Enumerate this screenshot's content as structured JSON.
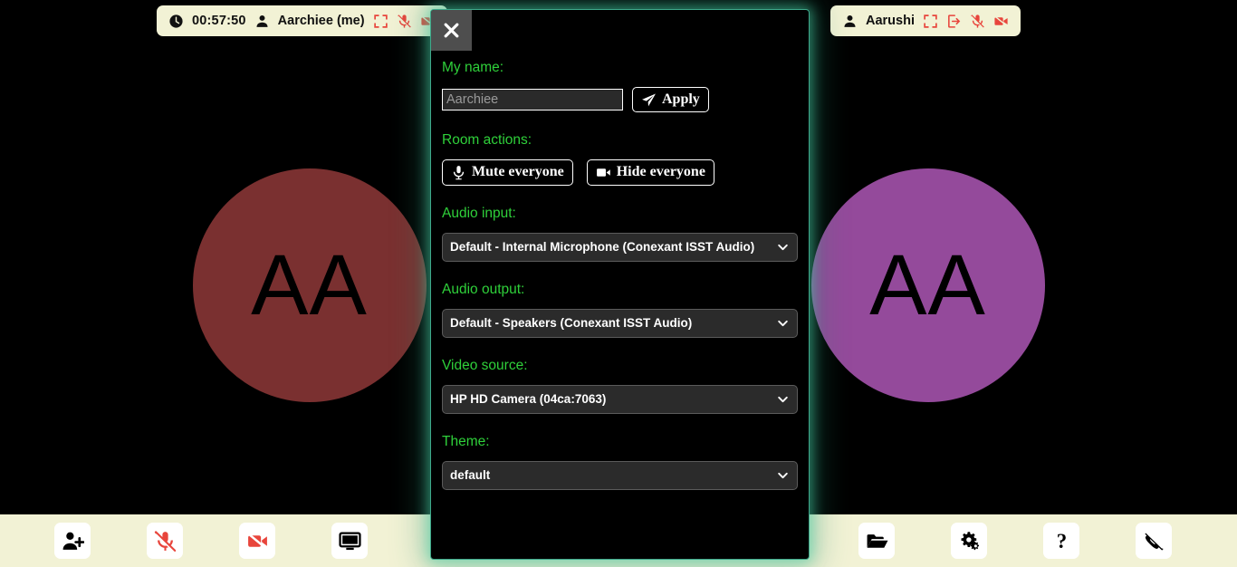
{
  "app": {
    "background_color": "#000000",
    "bar_color": "#f2f2d5",
    "accent_color": "#2fd03a",
    "glow_color": "#48d6aa",
    "danger_color": "#e8453c"
  },
  "participants": [
    {
      "timer": "00:57:50",
      "name": "Aarchiee (me)",
      "initials": "AA",
      "avatar_color": "#7a3030",
      "icons": [
        "clock-icon",
        "person-icon",
        "fullscreen-icon",
        "mic-muted-icon",
        "video-muted-icon"
      ]
    },
    {
      "name": "Aarushi",
      "initials": "AA",
      "avatar_color": "#944a9b",
      "icons": [
        "person-icon",
        "fullscreen-icon",
        "kick-icon",
        "mic-muted-icon",
        "video-muted-icon"
      ]
    }
  ],
  "toolbar": {
    "left_buttons": [
      {
        "name": "invite-user-button",
        "icon": "person-plus-icon",
        "color": "#000000"
      },
      {
        "name": "toggle-microphone-button",
        "icon": "mic-muted-icon",
        "color": "#e8453c"
      },
      {
        "name": "toggle-camera-button",
        "icon": "video-muted-icon",
        "color": "#e8453c"
      },
      {
        "name": "share-screen-button",
        "icon": "monitor-icon",
        "color": "#000000"
      }
    ],
    "right_buttons": [
      {
        "name": "file-share-button",
        "icon": "folder-open-icon",
        "color": "#000000"
      },
      {
        "name": "settings-button",
        "icon": "gears-icon",
        "color": "#000000"
      },
      {
        "name": "help-button",
        "icon": "question-mark-icon",
        "color": "#000000"
      },
      {
        "name": "hangup-button",
        "icon": "phone-hangup-icon",
        "color": "#000000"
      }
    ]
  },
  "dialog": {
    "close_label": "×",
    "my_name": {
      "label": "My name:",
      "input_value": "",
      "input_placeholder": "Aarchiee",
      "apply_label": "Apply",
      "apply_icon": "paper-plane-icon"
    },
    "room_actions": {
      "label": "Room actions:",
      "mute_everyone_label": "Mute everyone",
      "mute_everyone_icon": "microphone-icon",
      "hide_everyone_label": "Hide everyone",
      "hide_everyone_icon": "video-camera-icon"
    },
    "audio_input": {
      "label": "Audio input:",
      "selected": "Default - Internal Microphone (Conexant ISST Audio)"
    },
    "audio_output": {
      "label": "Audio output:",
      "selected": "Default - Speakers (Conexant ISST Audio)"
    },
    "video_source": {
      "label": "Video source:",
      "selected": "HP HD Camera (04ca:7063)"
    },
    "theme": {
      "label": "Theme:",
      "selected": "default"
    }
  }
}
